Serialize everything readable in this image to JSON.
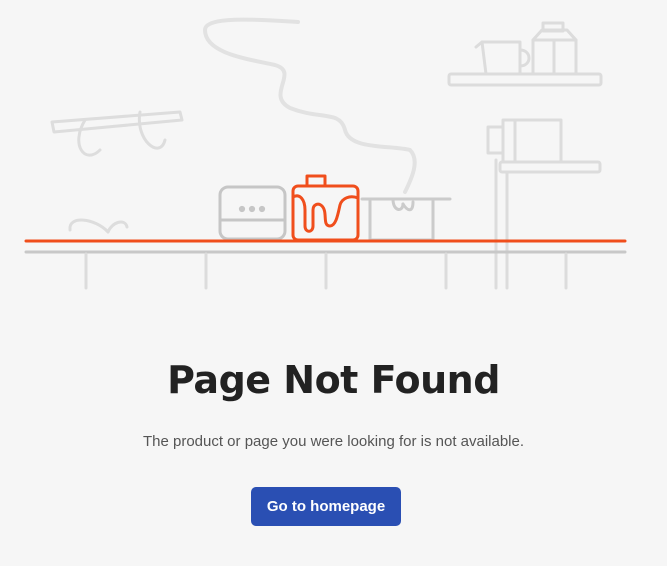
{
  "error_page": {
    "title": "Page Not Found",
    "message": "The product or page you were looking for is not available.",
    "home_button_label": "Go to homepage"
  },
  "colors": {
    "background": "#f6f6f6",
    "accent": "#f04e1c",
    "line_art": "#d6d6d6",
    "shelf": "#c8c8c8",
    "button": "#2a4fb3",
    "title": "#222222",
    "message": "#555555"
  }
}
